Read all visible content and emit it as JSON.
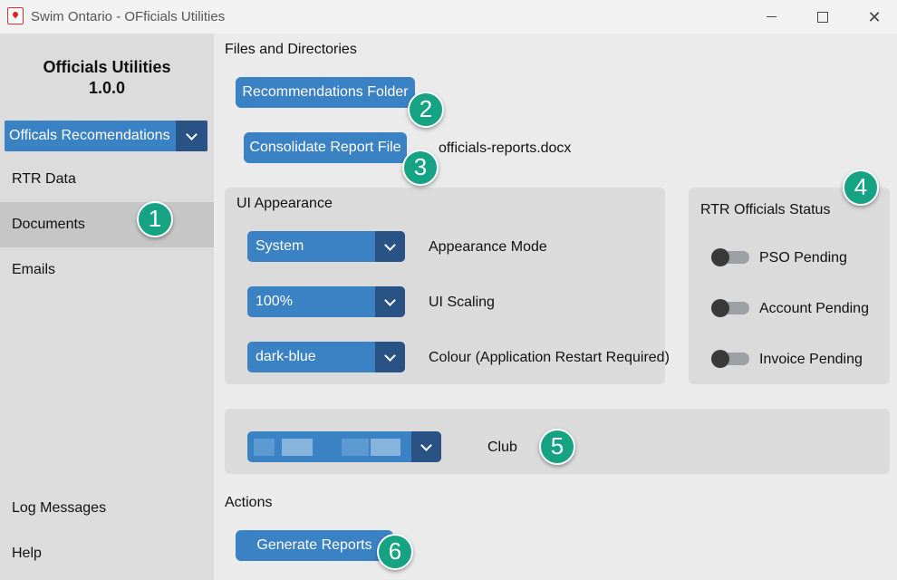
{
  "window": {
    "title": "Swim Ontario - OFficials Utilities"
  },
  "sidebar": {
    "app_name": "Officials Utilities",
    "version": "1.0.0",
    "selector_value": "Officals Recomendations",
    "items": [
      {
        "label": "RTR Data"
      },
      {
        "label": "Documents",
        "active": true
      },
      {
        "label": "Emails"
      },
      {
        "label": "Log Messages"
      },
      {
        "label": "Help"
      }
    ]
  },
  "files": {
    "section_title": "Files and Directories",
    "recommendations_button": "Recommendations Folder",
    "consolidate_button": "Consolidate Report File",
    "consolidate_filename": "officials-reports.docx"
  },
  "appearance": {
    "section_title": "UI Appearance",
    "rows": [
      {
        "value": "System",
        "label": "Appearance Mode"
      },
      {
        "value": "100%",
        "label": "UI Scaling"
      },
      {
        "value": "dark-blue",
        "label": "Colour (Application Restart Required)"
      }
    ]
  },
  "rtr_status": {
    "section_title": "RTR Officials Status",
    "toggles": [
      {
        "label": "PSO Pending",
        "on": false
      },
      {
        "label": "Account Pending",
        "on": false
      },
      {
        "label": "Invoice Pending",
        "on": false
      }
    ]
  },
  "club": {
    "label": "Club"
  },
  "actions": {
    "section_title": "Actions",
    "generate_button": "Generate Reports"
  },
  "badges": [
    "1",
    "2",
    "3",
    "4",
    "5",
    "6"
  ],
  "colors": {
    "accent": "#3b82c4",
    "accent_dark": "#2a5385",
    "badge": "#16a384"
  }
}
